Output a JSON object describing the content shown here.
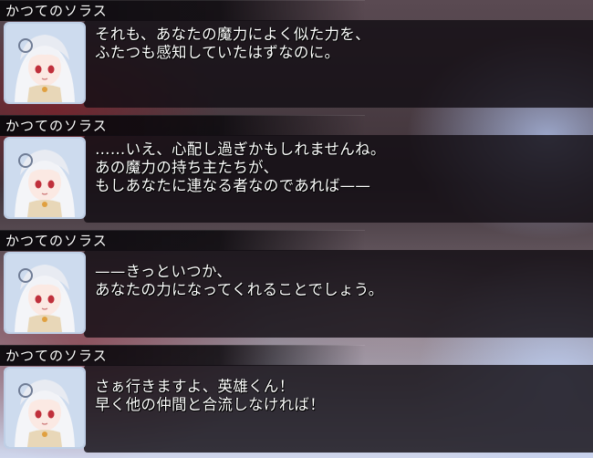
{
  "entries": [
    {
      "speaker": "かつてのソラス",
      "text": "それも、あなたの魔力によく似た力を、\nふたつも感知していたはずなのに。"
    },
    {
      "speaker": "かつてのソラス",
      "text": "……いえ、心配し過ぎかもしれませんね。\nあの魔力の持ち主たちが、\nもしあなたに連なる者なのであれば——"
    },
    {
      "speaker": "かつてのソラス",
      "text": "——きっといつか、\nあなたの力になってくれることでしょう。"
    },
    {
      "speaker": "かつてのソラス",
      "text": "さぁ行きますよ、英雄くん！\n早く他の仲間と合流しなければ！"
    }
  ]
}
